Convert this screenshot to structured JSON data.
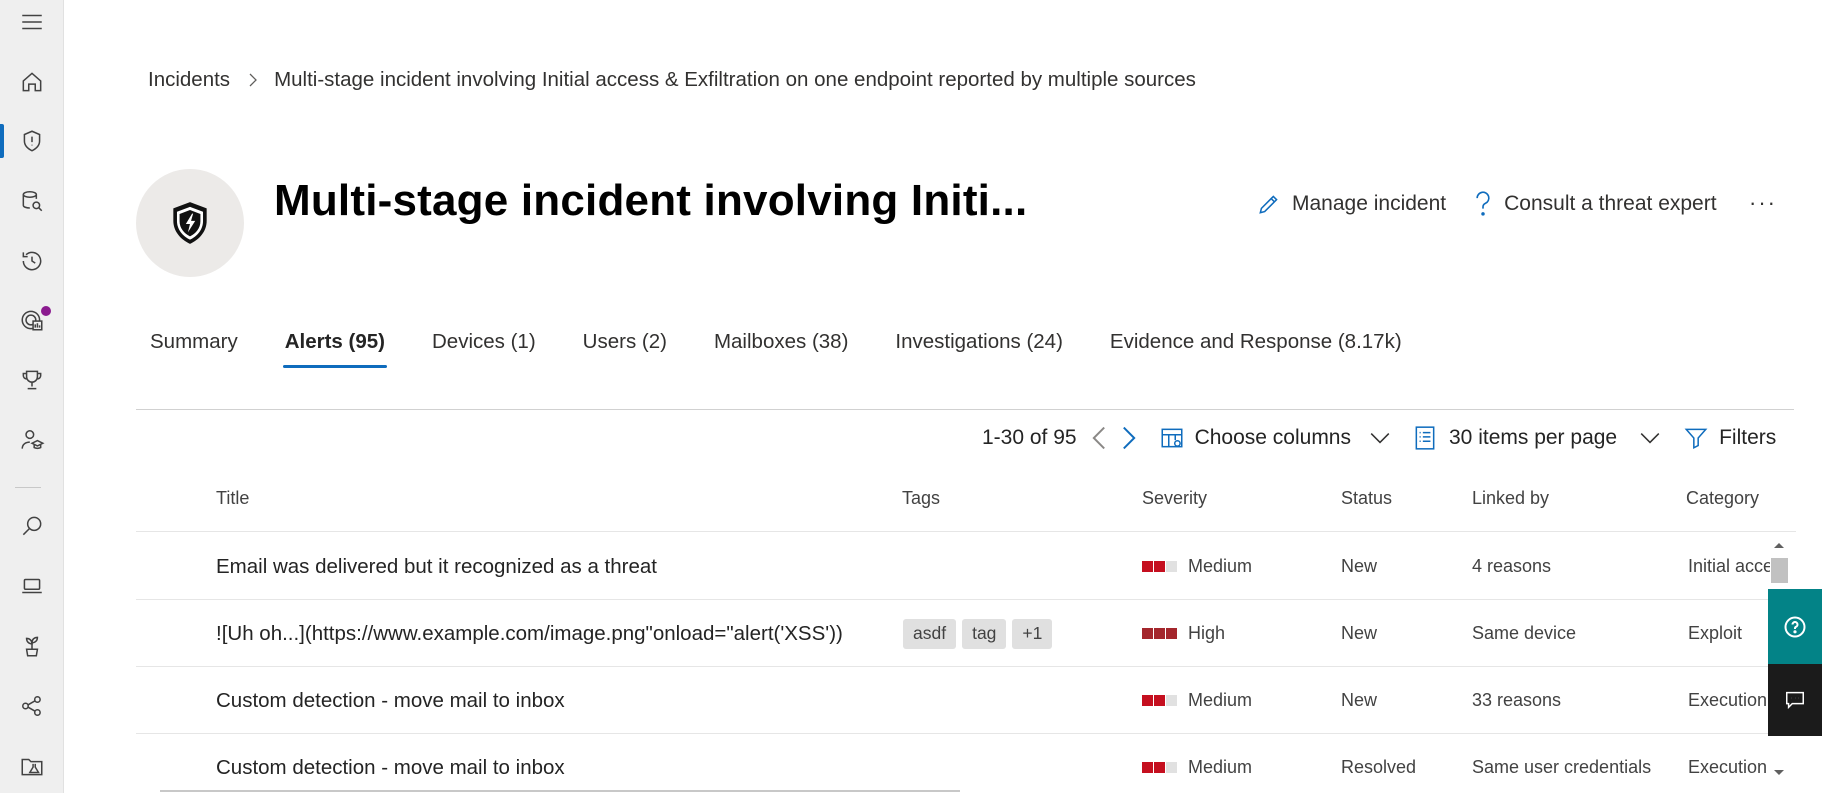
{
  "breadcrumb": {
    "root": "Incidents",
    "current": "Multi-stage incident involving Initial access & Exfiltration on one endpoint reported by multiple sources"
  },
  "header": {
    "title": "Multi-stage incident involving Initi...",
    "manage_label": "Manage incident",
    "consult_label": "Consult a threat expert",
    "more_label": "···"
  },
  "tabs": [
    {
      "label": "Summary"
    },
    {
      "label": "Alerts (95)",
      "active": true
    },
    {
      "label": "Devices (1)"
    },
    {
      "label": "Users (2)"
    },
    {
      "label": "Mailboxes (38)"
    },
    {
      "label": "Investigations (24)"
    },
    {
      "label": "Evidence and Response (8.17k)"
    }
  ],
  "toolbar": {
    "pager": "1-30 of 95",
    "choose_columns": "Choose columns",
    "items_per_page": "30 items per page",
    "filters": "Filters"
  },
  "table": {
    "columns": [
      "Title",
      "Tags",
      "Severity",
      "Status",
      "Linked by",
      "Category"
    ],
    "rows": [
      {
        "title": "Email was delivered but it recognized as a threat",
        "tags": [],
        "severity": "Medium",
        "severity_level": 2,
        "status": "New",
        "linked_by": "4 reasons",
        "category": "Initial acce"
      },
      {
        "title": "![Uh oh...](https://www.example.com/image.png\"onload=\"alert('XSS'))",
        "tags": [
          "asdf",
          "tag",
          "+1"
        ],
        "severity": "High",
        "severity_level": 3,
        "status": "New",
        "linked_by": "Same device",
        "category": "Exploit"
      },
      {
        "title": "Custom detection - move mail to inbox",
        "tags": [],
        "severity": "Medium",
        "severity_level": 2,
        "status": "New",
        "linked_by": "33 reasons",
        "category": "Execution"
      },
      {
        "title": "Custom detection - move mail to inbox",
        "tags": [],
        "severity": "Medium",
        "severity_level": 2,
        "status": "Resolved",
        "linked_by": "Same user credentials",
        "category": "Execution"
      }
    ]
  },
  "colors": {
    "accent": "#0f6cbd",
    "severity_red": "#c50f1f",
    "severity_high": "#a4262c",
    "severity_empty": "#e1e1e1",
    "help_teal": "#038387",
    "nav_bg": "#efefef"
  },
  "nav_icons": [
    "hamburger-icon",
    "home-icon",
    "shield-icon",
    "database-search-icon",
    "history-icon",
    "threat-analytics-icon",
    "trophy-icon",
    "learning-hub-icon",
    "search-icon",
    "laptop-icon",
    "plant-icon",
    "graph-icon",
    "lab-icon"
  ]
}
